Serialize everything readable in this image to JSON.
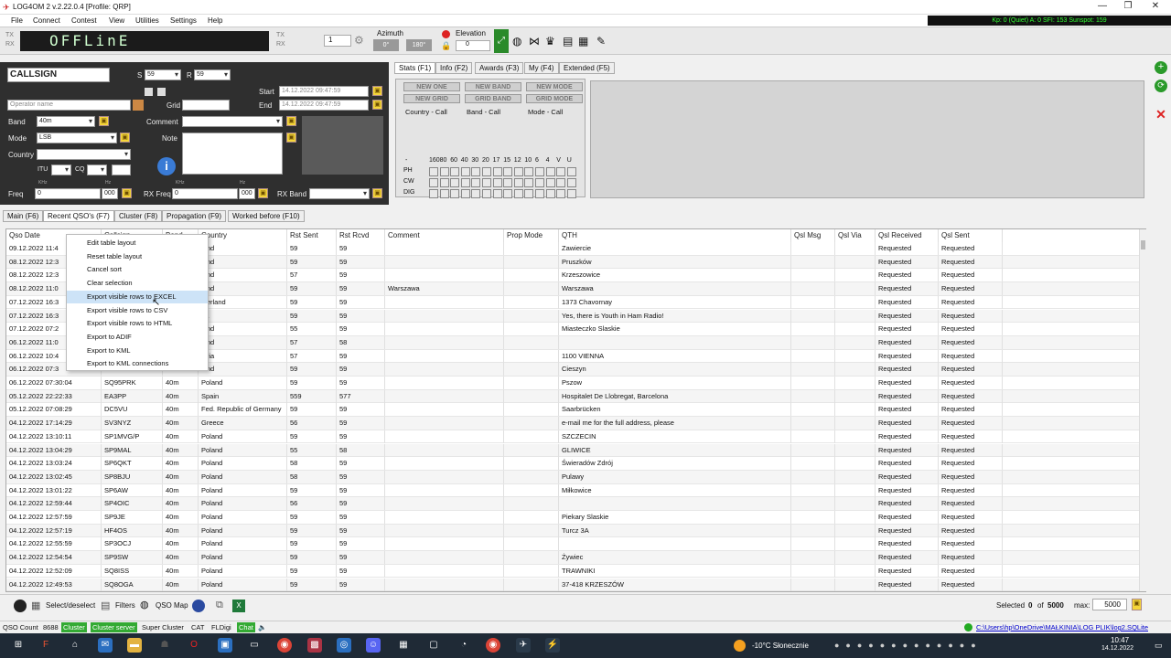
{
  "window": {
    "title": "LOG4OM 2 v.2.22.0.4 [Profile: QRP]",
    "minimize": "—",
    "maximize": "❐",
    "close": "✕"
  },
  "menu": [
    "File",
    "Connect",
    "Contest",
    "View",
    "Utilities",
    "Settings",
    "Help"
  ],
  "solar": "Kp: 0 (Quiet) A: 0 SFI: 153 Sunspot: 159",
  "toolbar": {
    "display": "OFFLinE",
    "tx_label": "TX",
    "rx_label": "RX",
    "tx_label2": "TX",
    "rx_label2": "RX",
    "counter": "1",
    "azimuth_label": "Azimuth",
    "azimuth_a": "0°",
    "azimuth_b": "180°",
    "elevation_label": "Elevation",
    "elevation_value": "0"
  },
  "qso_form": {
    "callsign_placeholder": "CALLSIGN",
    "s_label": "S",
    "s_value": "59",
    "r_label": "R",
    "r_value": "59",
    "operator_placeholder": "Operator name",
    "grid_label": "Grid",
    "start_label": "Start",
    "start_value": "14.12.2022 09:47:59",
    "end_label": "End",
    "end_value": "14.12.2022 09:47:59",
    "band_label": "Band",
    "band_value": "40m",
    "comment_label": "Comment",
    "mode_label": "Mode",
    "mode_value": "LSB",
    "note_label": "Note",
    "country_label": "Country",
    "itu_label": "ITU",
    "cq_label": "CQ",
    "freq_label": "Freq",
    "khz": "KHz",
    "hz": "Hz",
    "freq_value": "0",
    "freq_hz": "000",
    "rx_freq_label": "RX Freq",
    "rx_freq_value": "0",
    "rx_freq_hz": "000",
    "rx_band_label": "RX Band"
  },
  "stat_tabs": [
    "Stats (F1)",
    "Info (F2)",
    "Awards (F3)",
    "My (F4)",
    "Extended (F5)"
  ],
  "stats": {
    "new_one": "NEW ONE",
    "new_band": "NEW BAND",
    "new_mode": "NEW MODE",
    "new_grid": "NEW GRID",
    "grid_band": "GRID BAND",
    "grid_mode": "GRID MODE",
    "country_call": "Country - Call",
    "band_call": "Band - Call",
    "mode_call": "Mode - Call",
    "dash": "-",
    "bands": [
      "160",
      "80",
      "60",
      "40",
      "30",
      "20",
      "17",
      "15",
      "12",
      "10",
      "6",
      "4",
      "V",
      "U"
    ],
    "modes": [
      "PH",
      "CW",
      "DIG"
    ]
  },
  "main_tabs": [
    "Main (F6)",
    "Recent QSO's (F7)",
    "Cluster (F8)",
    "Propagation (F9)",
    "Worked before (F10)"
  ],
  "table": {
    "headers": [
      "Qso Date",
      "Callsign",
      "Band",
      "Country",
      "Rst Sent",
      "Rst Rcvd",
      "Comment",
      "Prop Mode",
      "QTH",
      "Qsl Msg",
      "Qsl Via",
      "Qsl Received",
      "Qsl Sent"
    ],
    "rows": [
      [
        "09.12.2022 11:4",
        "",
        "",
        "land",
        "59",
        "59",
        "",
        "",
        "Zawiercie",
        "",
        "",
        "Requested",
        "Requested"
      ],
      [
        "08.12.2022 12:3",
        "",
        "",
        "land",
        "59",
        "59",
        "",
        "",
        "Pruszków",
        "",
        "",
        "Requested",
        "Requested"
      ],
      [
        "08.12.2022 12:3",
        "",
        "",
        "land",
        "57",
        "59",
        "",
        "",
        "Krzeszowice",
        "",
        "",
        "Requested",
        "Requested"
      ],
      [
        "08.12.2022 11:0",
        "",
        "",
        "land",
        "59",
        "59",
        "Warszawa",
        "",
        "Warszawa",
        "",
        "",
        "Requested",
        "Requested"
      ],
      [
        "07.12.2022 16:3",
        "",
        "",
        "tzerland",
        "59",
        "59",
        "",
        "",
        "1373 Chavornay",
        "",
        "",
        "Requested",
        "Requested"
      ],
      [
        "07.12.2022 16:3",
        "",
        "",
        "ba",
        "59",
        "59",
        "",
        "",
        "Yes, there is Youth in Ham Radio!",
        "",
        "",
        "Requested",
        "Requested"
      ],
      [
        "07.12.2022 07:2",
        "",
        "",
        "land",
        "55",
        "59",
        "",
        "",
        "Miasteczko Slaskie",
        "",
        "",
        "Requested",
        "Requested"
      ],
      [
        "06.12.2022 11:0",
        "",
        "",
        "land",
        "57",
        "58",
        "",
        "",
        "",
        "",
        "",
        "Requested",
        "Requested"
      ],
      [
        "06.12.2022 10:4",
        "",
        "",
        "stria",
        "57",
        "59",
        "",
        "",
        "1100 VIENNA",
        "",
        "",
        "Requested",
        "Requested"
      ],
      [
        "06.12.2022 07:3",
        "",
        "",
        "land",
        "59",
        "59",
        "",
        "",
        "Cieszyn",
        "",
        "",
        "Requested",
        "Requested"
      ],
      [
        "06.12.2022 07:30:04",
        "SQ95PRK",
        "40m",
        "Poland",
        "59",
        "59",
        "",
        "",
        "Pszow",
        "",
        "",
        "Requested",
        "Requested"
      ],
      [
        "05.12.2022 22:22:33",
        "EA3PP",
        "40m",
        "Spain",
        "559",
        "577",
        "",
        "",
        "Hospitalet De Llobregat, Barcelona",
        "",
        "",
        "Requested",
        "Requested"
      ],
      [
        "05.12.2022 07:08:29",
        "DC5VU",
        "40m",
        "Fed. Republic of Germany",
        "59",
        "59",
        "",
        "",
        "Saarbrücken",
        "",
        "",
        "Requested",
        "Requested"
      ],
      [
        "04.12.2022 17:14:29",
        "SV3NYZ",
        "40m",
        "Greece",
        "56",
        "59",
        "",
        "",
        "e-mail me for the full address, please",
        "",
        "",
        "Requested",
        "Requested"
      ],
      [
        "04.12.2022 13:10:11",
        "SP1MVG/P",
        "40m",
        "Poland",
        "59",
        "59",
        "",
        "",
        "SZCZECIN",
        "",
        "",
        "Requested",
        "Requested"
      ],
      [
        "04.12.2022 13:04:29",
        "SP9MAL",
        "40m",
        "Poland",
        "55",
        "58",
        "",
        "",
        "GLIWICE",
        "",
        "",
        "Requested",
        "Requested"
      ],
      [
        "04.12.2022 13:03:24",
        "SP6QKT",
        "40m",
        "Poland",
        "58",
        "59",
        "",
        "",
        "Świeradów Zdrój",
        "",
        "",
        "Requested",
        "Requested"
      ],
      [
        "04.12.2022 13:02:45",
        "SP8BJU",
        "40m",
        "Poland",
        "58",
        "59",
        "",
        "",
        "Pulawy",
        "",
        "",
        "Requested",
        "Requested"
      ],
      [
        "04.12.2022 13:01:22",
        "SP6AW",
        "40m",
        "Poland",
        "59",
        "59",
        "",
        "",
        "Miłkowice",
        "",
        "",
        "Requested",
        "Requested"
      ],
      [
        "04.12.2022 12:59:44",
        "SP4OIC",
        "40m",
        "Poland",
        "56",
        "59",
        "",
        "",
        "",
        "",
        "",
        "Requested",
        "Requested"
      ],
      [
        "04.12.2022 12:57:59",
        "SP9JE",
        "40m",
        "Poland",
        "59",
        "59",
        "",
        "",
        "Piekary Slaskie",
        "",
        "",
        "Requested",
        "Requested"
      ],
      [
        "04.12.2022 12:57:19",
        "HF4OS",
        "40m",
        "Poland",
        "59",
        "59",
        "",
        "",
        "Turcz 3A",
        "",
        "",
        "Requested",
        "Requested"
      ],
      [
        "04.12.2022 12:55:59",
        "SP3OCJ",
        "40m",
        "Poland",
        "59",
        "59",
        "",
        "",
        "",
        "",
        "",
        "Requested",
        "Requested"
      ],
      [
        "04.12.2022 12:54:54",
        "SP9SW",
        "40m",
        "Poland",
        "59",
        "59",
        "",
        "",
        "Żywiec",
        "",
        "",
        "Requested",
        "Requested"
      ],
      [
        "04.12.2022 12:52:09",
        "SQ8ISS",
        "40m",
        "Poland",
        "59",
        "59",
        "",
        "",
        "TRAWNIKI",
        "",
        "",
        "Requested",
        "Requested"
      ],
      [
        "04.12.2022 12:49:53",
        "SQ8OGA",
        "40m",
        "Poland",
        "59",
        "59",
        "",
        "",
        "37-418 KRZESZÓW",
        "",
        "",
        "Requested",
        "Requested"
      ]
    ]
  },
  "context_menu": [
    "Edit table layout",
    "Reset table layout",
    "Cancel sort",
    "Clear selection",
    "Export visible rows to EXCEL",
    "Export visible rows to CSV",
    "Export visible rows to HTML",
    "Export to ADIF",
    "Export to KML",
    "Export to KML connections"
  ],
  "bottom": {
    "select_deselect": "Select/deselect",
    "filters": "Filters",
    "qso_map": "QSO Map",
    "selected_label": "Selected",
    "selected_count": "0",
    "of_label": "of",
    "total": "5000",
    "max_label": "max:",
    "max_value": "5000"
  },
  "status": {
    "qso_count_label": "QSO Count",
    "qso_count": "8688",
    "cluster": "Cluster",
    "cluster_server": "Cluster server",
    "super_cluster": "Super Cluster",
    "cat": "CAT",
    "fldigi": "FLDigi",
    "chat": "Chat",
    "db_path": "C:\\Users\\hp\\OneDrive\\MAŁKINIA\\LOG PLIK\\log2.SQLite"
  },
  "taskbar": {
    "weather": "-10°C Słonecznie",
    "time": "10:47",
    "date": "14.12.2022"
  },
  "colors": {
    "accent": "#3a9b3a",
    "dark_panel": "#2f2f2f",
    "highlight": "#cde3f7",
    "taskbar": "#1f2a36"
  }
}
